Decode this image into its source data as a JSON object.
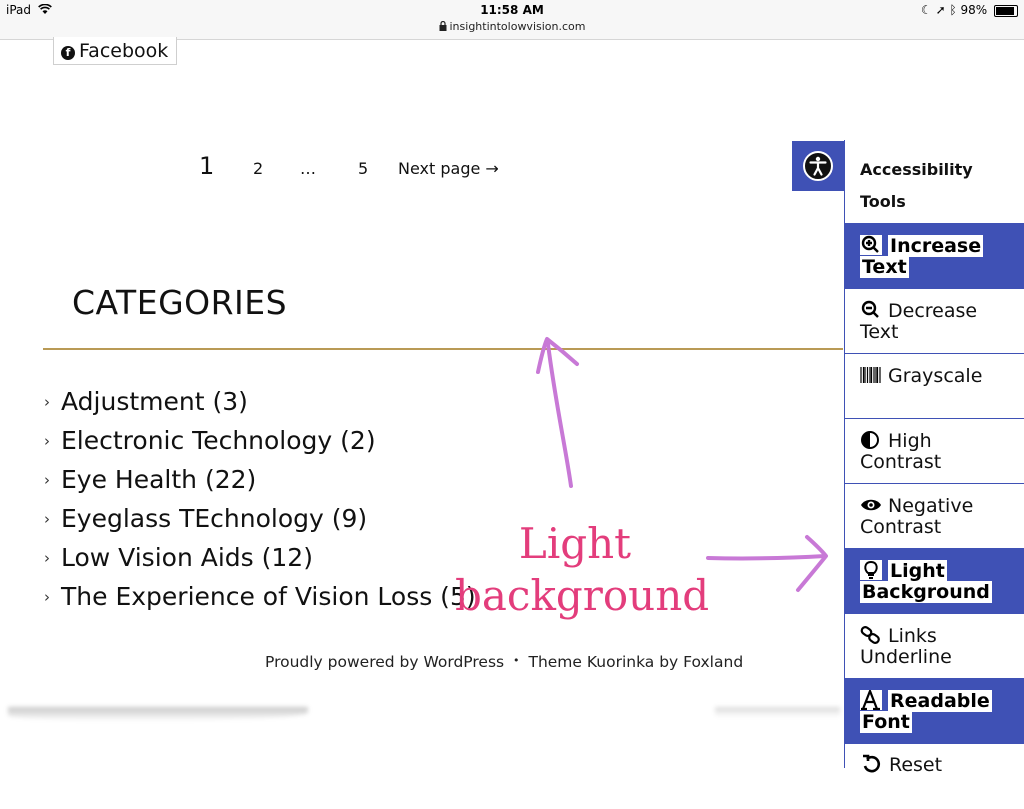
{
  "status_bar": {
    "device": "iPad",
    "time": "11:58 AM",
    "url": "insightintolowvision.com",
    "battery": "98%",
    "battery_level": 0.98
  },
  "facebook_button": {
    "label": "Facebook"
  },
  "pagination": {
    "current": "1",
    "pages": [
      "2",
      "…",
      "5"
    ],
    "next": "Next page →"
  },
  "categories": {
    "title": "CATEGORIES",
    "items": [
      "Adjustment (3)",
      "Electronic Technology (2)",
      "Eye Health (22)",
      "Eyeglass TEchnology (9)",
      "Low Vision Aids (12)",
      "The Experience of Vision Loss (5)"
    ]
  },
  "footer": {
    "powered": "Proudly powered by WordPress",
    "separator": "•",
    "theme": "Theme Kuorinka by Foxland"
  },
  "annotation": {
    "line1": "Light",
    "line2": "background",
    "color": "#e33d7c",
    "arrow_color": "#c879d6"
  },
  "accessibility": {
    "title": "Accessibility Tools",
    "accent": "#3f51b5",
    "items": [
      {
        "label": "Increase Text",
        "icon": "zoom-in-icon",
        "active": true
      },
      {
        "label": "Decrease Text",
        "icon": "zoom-out-icon",
        "active": false
      },
      {
        "label": "Grayscale",
        "icon": "barcode-icon",
        "active": false
      },
      {
        "label": "High Contrast",
        "icon": "half-circle-icon",
        "active": false
      },
      {
        "label": "Negative Contrast",
        "icon": "eye-icon",
        "active": false
      },
      {
        "label": "Light Background",
        "icon": "lightbulb-icon",
        "active": true
      },
      {
        "label": "Links Underline",
        "icon": "link-icon",
        "active": false
      },
      {
        "label": "Readable Font",
        "icon": "font-icon",
        "active": true
      }
    ],
    "reset": "Reset"
  }
}
